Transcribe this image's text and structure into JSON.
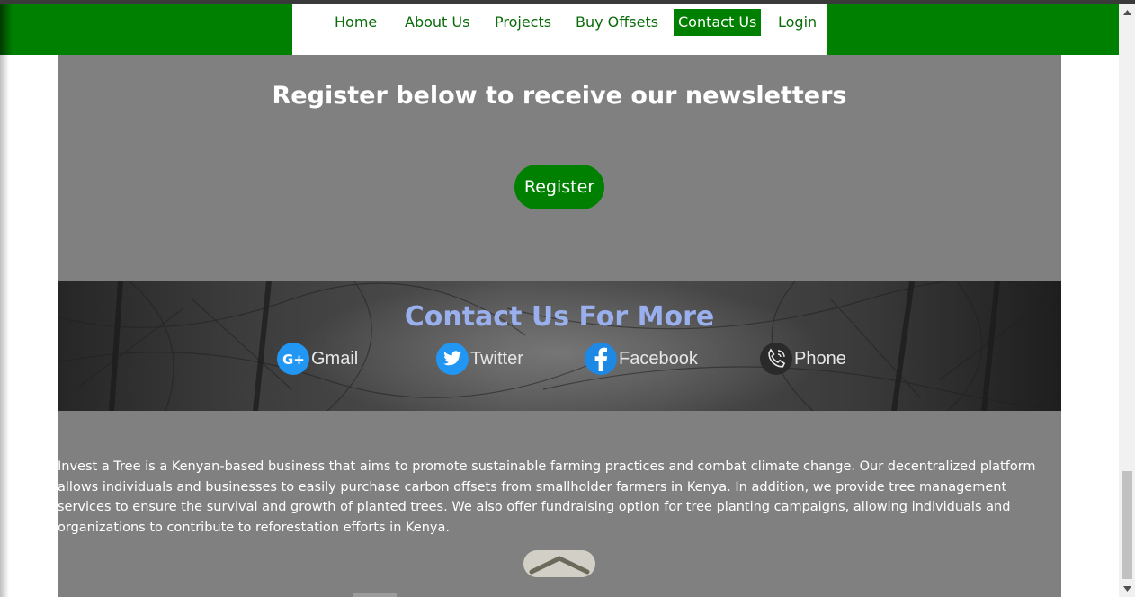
{
  "nav": {
    "items": [
      {
        "label": "Home",
        "active": false
      },
      {
        "label": "About Us",
        "active": false
      },
      {
        "label": "Projects",
        "active": false
      },
      {
        "label": "Buy Offsets",
        "active": false
      },
      {
        "label": "Contact Us",
        "active": true
      },
      {
        "label": "Login",
        "active": false
      }
    ]
  },
  "newsletter": {
    "title": "Register below to receive our newsletters",
    "button_label": "Register"
  },
  "contact": {
    "title": "Contact Us For More",
    "links": [
      {
        "label": "Gmail",
        "icon": "google-plus-icon"
      },
      {
        "label": "Twitter",
        "icon": "twitter-icon"
      },
      {
        "label": "Facebook",
        "icon": "facebook-icon"
      },
      {
        "label": "Phone",
        "icon": "phone-icon"
      }
    ]
  },
  "about": {
    "text": "Invest a Tree is a Kenyan-based business that aims to promote sustainable farming practices and combat climate change. Our decentralized platform allows individuals and businesses to easily purchase carbon offsets from smallholder farmers in Kenya. In addition, we provide tree management services to ensure the survival and growth of planted trees. We also offer fundraising option for tree planting campaigns, allowing individuals and organizations to contribute to reforestation efforts in Kenya."
  },
  "colors": {
    "brand_green": "#008000",
    "page_gray": "#808080",
    "contact_title": "#9ab0ee"
  },
  "icons": {
    "scroll_top": "chevron-up-icon"
  }
}
